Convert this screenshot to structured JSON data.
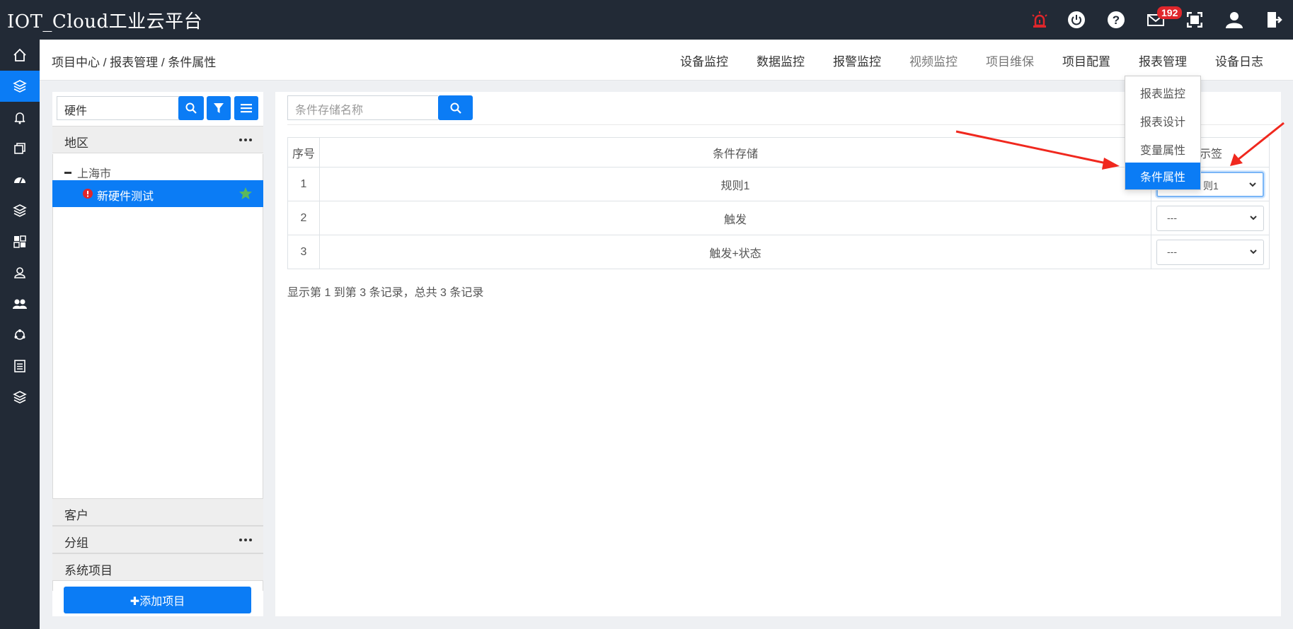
{
  "app": {
    "title": "IOT_Cloud工业云平台",
    "mail_count": "192"
  },
  "colors": {
    "accent": "#0b7cf5",
    "topbar": "#222a36",
    "alarm": "#e0262b"
  },
  "top_icons": [
    "alarm-light-icon",
    "power-icon",
    "help-icon",
    "mail-icon",
    "fullscreen-icon",
    "user-icon",
    "logout-icon"
  ],
  "sidebar": {
    "items": [
      "home-icon",
      "layers-icon",
      "bell-icon",
      "copy-icon",
      "dashboard-icon",
      "layers-icon",
      "grid-icon",
      "user-stamp-icon",
      "group-icon",
      "network-icon",
      "list-icon",
      "layers-icon"
    ],
    "active_index": 1
  },
  "header": {
    "breadcrumb": "项目中心 / 报表管理 / 条件属性",
    "nav": [
      "设备监控",
      "数据监控",
      "报警监控",
      "视频监控",
      "项目维保",
      "项目配置",
      "报表管理",
      "设备日志"
    ]
  },
  "dropdown": {
    "items": [
      "报表监控",
      "报表设计",
      "变量属性",
      "条件属性"
    ],
    "active_index": 3
  },
  "left_panel": {
    "search_value": "硬件",
    "sections": {
      "region": "地区",
      "customer": "客户",
      "group": "分组",
      "system": "系统项目"
    },
    "tree": {
      "root": "上海市",
      "selected": "新硬件测试"
    },
    "add_button": "✚添加项目"
  },
  "main": {
    "search_placeholder": "条件存储名称",
    "table": {
      "headers": [
        "序号",
        "条件存储",
        "标签"
      ],
      "header_label_visible": "示签",
      "rows": [
        {
          "index": "1",
          "name": "规则1",
          "select": "则1"
        },
        {
          "index": "2",
          "name": "触发",
          "select": "---"
        },
        {
          "index": "3",
          "name": "触发+状态",
          "select": "---"
        }
      ]
    },
    "pagination": "显示第 1 到第 3 条记录，总共 3 条记录"
  }
}
